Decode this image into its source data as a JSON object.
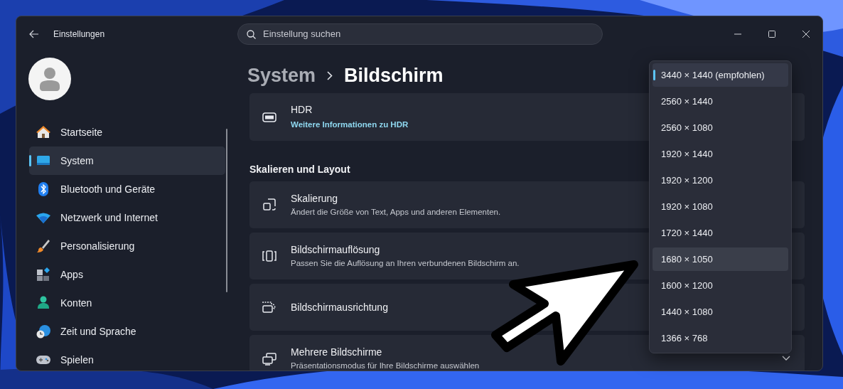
{
  "window": {
    "title": "Einstellungen"
  },
  "search": {
    "placeholder": "Einstellung suchen"
  },
  "sidebar": {
    "items": [
      {
        "label": "Startseite",
        "selected": false
      },
      {
        "label": "System",
        "selected": true
      },
      {
        "label": "Bluetooth und Geräte",
        "selected": false
      },
      {
        "label": "Netzwerk und Internet",
        "selected": false
      },
      {
        "label": "Personalisierung",
        "selected": false
      },
      {
        "label": "Apps",
        "selected": false
      },
      {
        "label": "Konten",
        "selected": false
      },
      {
        "label": "Zeit und Sprache",
        "selected": false
      },
      {
        "label": "Spielen",
        "selected": false
      }
    ]
  },
  "breadcrumb": [
    "System",
    "Bildschirm"
  ],
  "hdr_card": {
    "title": "HDR",
    "link": "Weitere Informationen zu HDR"
  },
  "section_heading": "Skalieren und Layout",
  "cards": [
    {
      "kind": "plain",
      "title": "Skalierung",
      "description": "Ändert die Größe von Text, Apps und anderen Elementen."
    },
    {
      "kind": "plain",
      "title": "Bildschirmauflösung",
      "description": "Passen Sie die Auflösung an Ihren verbundenen Bildschirm an."
    },
    {
      "kind": "plain",
      "title": "Bildschirmausrichtung"
    },
    {
      "kind": "expander",
      "title": "Mehrere Bildschirme",
      "description": "Präsentationsmodus für Ihre Bildschirme auswählen"
    }
  ],
  "resolution_menu": {
    "options": [
      {
        "label": "3440 × 1440 (empfohlen)",
        "selected": true,
        "hovered": false
      },
      {
        "label": "2560 × 1440",
        "selected": false,
        "hovered": false
      },
      {
        "label": "2560 × 1080",
        "selected": false,
        "hovered": false
      },
      {
        "label": "1920 × 1440",
        "selected": false,
        "hovered": false
      },
      {
        "label": "1920 × 1200",
        "selected": false,
        "hovered": false
      },
      {
        "label": "1920 × 1080",
        "selected": false,
        "hovered": false
      },
      {
        "label": "1720 × 1440",
        "selected": false,
        "hovered": false
      },
      {
        "label": "1680 × 1050",
        "selected": false,
        "hovered": true
      },
      {
        "label": "1600 × 1200",
        "selected": false,
        "hovered": false
      },
      {
        "label": "1440 × 1080",
        "selected": false,
        "hovered": false
      },
      {
        "label": "1366 × 768",
        "selected": false,
        "hovered": false
      }
    ]
  }
}
